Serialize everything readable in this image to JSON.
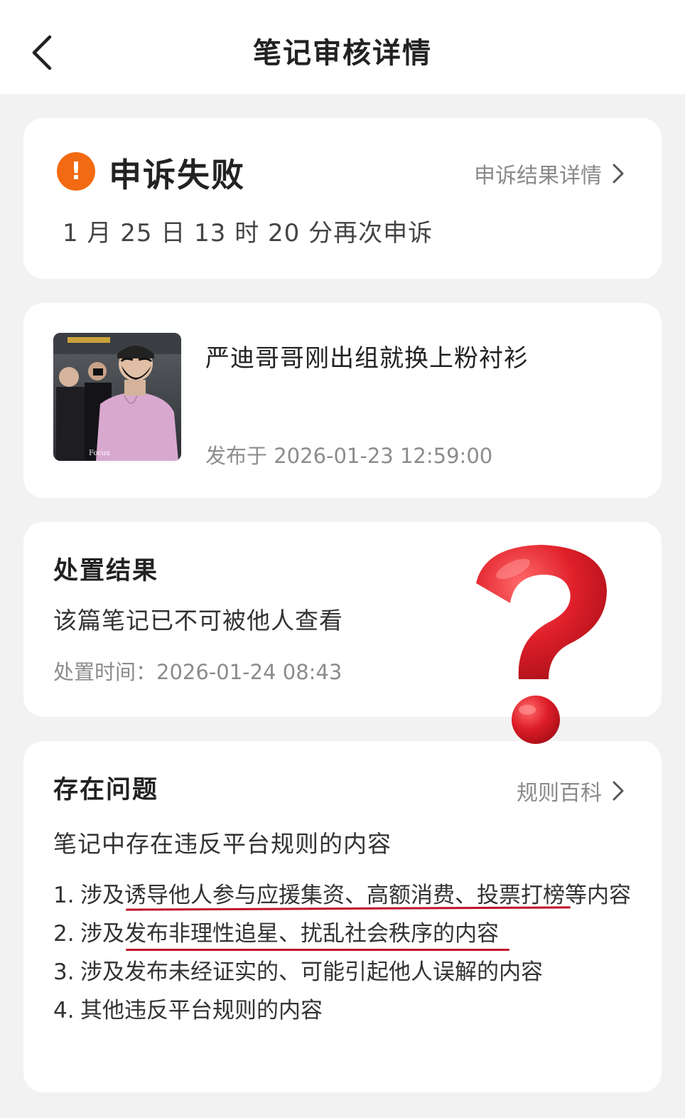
{
  "header": {
    "title": "笔记审核详情"
  },
  "status_card": {
    "icon": "warning-icon",
    "title": "申诉失败",
    "link_label": "申诉结果详情",
    "subtitle": "1 月 25 日 13 时 20 分再次申诉"
  },
  "note_card": {
    "title": "严迪哥哥刚出组就换上粉衬衫",
    "published": "发布于 2026-01-23 12:59:00",
    "thumbnail_watermark": "Focus"
  },
  "result_card": {
    "section_title": "处置结果",
    "text": "该篇笔记已不可被他人查看",
    "time": "处置时间：2026-01-24 08:43"
  },
  "issues_card": {
    "section_title": "存在问题",
    "link_label": "规则百科",
    "summary": "笔记中存在违反平台规则的内容",
    "items": [
      {
        "num": "1.",
        "text": "涉及诱导他人参与应援集资、高额消费、投票打榜等内容"
      },
      {
        "num": "2.",
        "text": "涉及发布非理性追星、扰乱社会秩序的内容"
      },
      {
        "num": "3.",
        "text": "涉及发布未经证实的、可能引起他人误解的内容"
      },
      {
        "num": "4.",
        "text": "其他违反平台规则的内容"
      }
    ]
  },
  "colors": {
    "warning": "#f26a12",
    "underline": "#c0122b",
    "question_mark": "#e0202a"
  }
}
